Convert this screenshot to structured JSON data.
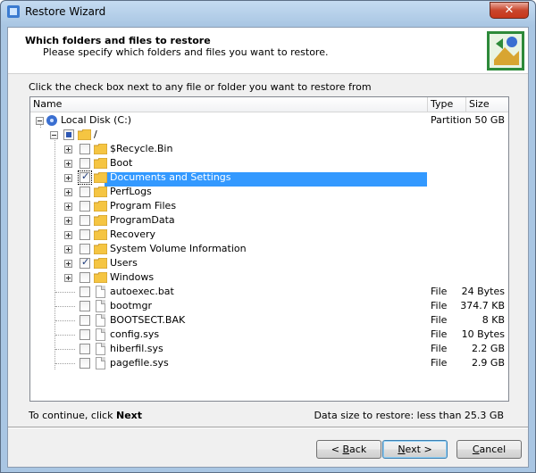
{
  "window": {
    "title": "Restore Wizard",
    "close_glyph": "✕"
  },
  "header": {
    "title": "Which folders and files to restore",
    "subtitle": "Please specify which folders and files you want to restore."
  },
  "instruction": "Click the check box next to any file or folder you want to restore from",
  "columns": {
    "name": "Name",
    "type": "Type",
    "size": "Size"
  },
  "tree": {
    "root": {
      "label": "Local Disk (C:)",
      "type": "Partition",
      "size": "50 GB",
      "icon": "disk-icon"
    },
    "slash": {
      "label": "/"
    },
    "folders": [
      {
        "label": "$Recycle.Bin",
        "checked": false
      },
      {
        "label": "Boot",
        "checked": false
      },
      {
        "label": "Documents and Settings",
        "checked": true,
        "selected": true
      },
      {
        "label": "PerfLogs",
        "checked": false
      },
      {
        "label": "Program Files",
        "checked": false
      },
      {
        "label": "ProgramData",
        "checked": false
      },
      {
        "label": "Recovery",
        "checked": false
      },
      {
        "label": "System Volume Information",
        "checked": false
      },
      {
        "label": "Users",
        "checked": true
      },
      {
        "label": "Windows",
        "checked": false
      }
    ],
    "files": [
      {
        "label": "autoexec.bat",
        "type": "File",
        "size": "24 Bytes"
      },
      {
        "label": "bootmgr",
        "type": "File",
        "size": "374.7 KB"
      },
      {
        "label": "BOOTSECT.BAK",
        "type": "File",
        "size": "8 KB"
      },
      {
        "label": "config.sys",
        "type": "File",
        "size": "10 Bytes"
      },
      {
        "label": "hiberfil.sys",
        "type": "File",
        "size": "2.2 GB"
      },
      {
        "label": "pagefile.sys",
        "type": "File",
        "size": "2.9 GB"
      }
    ]
  },
  "footer": {
    "continue_prefix": "To continue, click ",
    "continue_bold": "Next",
    "data_size": "Data size to restore: less than 25.3 GB"
  },
  "buttons": {
    "back_prefix": "< ",
    "back_key": "B",
    "back_rest": "ack",
    "next_key": "N",
    "next_rest": "ext >",
    "cancel_key": "C",
    "cancel_rest": "ancel"
  },
  "colors": {
    "selection": "#3399ff",
    "folder": "#f5c542",
    "titlebar": "#a9c6e3"
  }
}
